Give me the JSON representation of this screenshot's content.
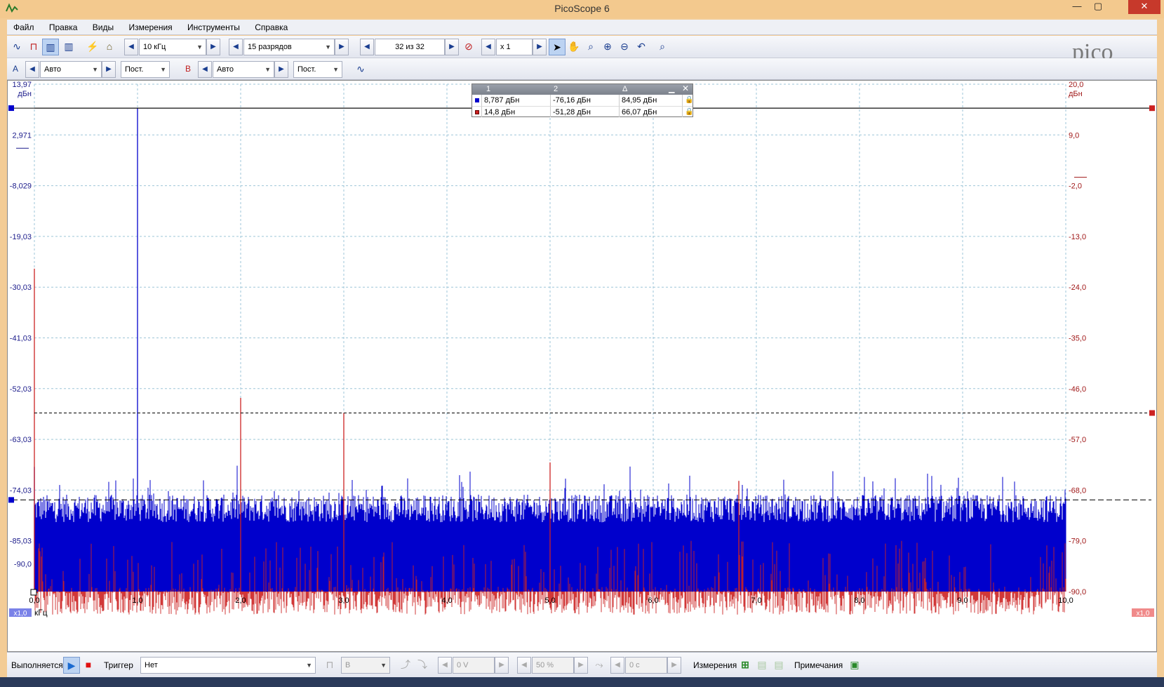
{
  "window": {
    "title": "PicoScope 6"
  },
  "menu": [
    "Файл",
    "Правка",
    "Виды",
    "Измерения",
    "Инструменты",
    "Справка"
  ],
  "toolbar1": {
    "sample_rate": "10 кГц",
    "resolution": "15 разрядов",
    "buffer": "32 из 32",
    "zoom": "x 1"
  },
  "toolbar2": {
    "channel_a": {
      "label": "A",
      "range": "Авто",
      "coupling": "Пост."
    },
    "channel_b": {
      "label": "B",
      "range": "Авто",
      "coupling": "Пост."
    }
  },
  "readout": {
    "headers": [
      "1",
      "2",
      "Δ"
    ],
    "rows": [
      {
        "channel": "A",
        "v1": "8,787 дБн",
        "v2": "-76,16 дБн",
        "delta": "84,95 дБн"
      },
      {
        "channel": "B",
        "v1": "14,8 дБн",
        "v2": "-51,28 дБн",
        "delta": "66,07 дБн"
      }
    ]
  },
  "bottombar": {
    "run_status": "Выполняется",
    "trigger_label": "Триггер",
    "trigger_mode": "Нет",
    "trigger_channel": "B",
    "trigger_level": "0 V",
    "pretrigger": "50 %",
    "delay": "0 с",
    "measurements_label": "Измерения",
    "notes_label": "Примечания"
  },
  "colors": {
    "channel_a": "#0000cc",
    "channel_b": "#cc2222",
    "grid": "#9ec6d8",
    "window": "#f3cc96"
  },
  "chart_data": {
    "type": "line",
    "xlabel": "кГц",
    "x_ticks": [
      "0,0",
      "1,0",
      "2,0",
      "3,0",
      "4,0",
      "5,0",
      "6,0",
      "7,0",
      "8,0",
      "9,0",
      "10,0"
    ],
    "xlim": [
      0,
      10
    ],
    "x_scale_tags": [
      "x1,0",
      "x1,0"
    ],
    "axes": {
      "left": {
        "unit": "дБн",
        "ticks": [
          "13,97",
          "2,971",
          "-8,029",
          "-19,03",
          "-30,03",
          "-41,03",
          "-52,03",
          "-63,03",
          "-74,03",
          "-85,03",
          "-90,0"
        ],
        "ylim": [
          -96.03,
          13.97
        ]
      },
      "right": {
        "unit": "дБн",
        "ticks": [
          "20,0",
          "9,0",
          "-2,0",
          "-13,0",
          "-24,0",
          "-35,0",
          "-46,0",
          "-57,0",
          "-68,0",
          "-79,0",
          "-90,0"
        ],
        "ylim": [
          -90,
          20
        ]
      }
    },
    "grid": true,
    "series": [
      {
        "channel": "A",
        "color": "#0000cc",
        "noise_floor": -78,
        "peaks": [
          {
            "x": 0.0,
            "y": -69
          },
          {
            "x": 1.0,
            "y": 8.787
          }
        ]
      },
      {
        "channel": "B",
        "color": "#cc2222",
        "noise_floor": -85,
        "peaks": [
          {
            "x": 0.0,
            "y": -20
          },
          {
            "x": 2.0,
            "y": -48
          },
          {
            "x": 3.0,
            "y": -51.28
          },
          {
            "x": 5.0,
            "y": -62
          },
          {
            "x": 6.83,
            "y": -66
          }
        ]
      }
    ],
    "rulers": [
      {
        "axis": "left",
        "y": 8.787,
        "style": "solid"
      },
      {
        "axis": "left",
        "y": -76.16,
        "style": "dashed"
      },
      {
        "axis": "right",
        "y": 14.8,
        "style": "solid"
      },
      {
        "axis": "right",
        "y": -51.28,
        "style": "dashed"
      }
    ]
  }
}
